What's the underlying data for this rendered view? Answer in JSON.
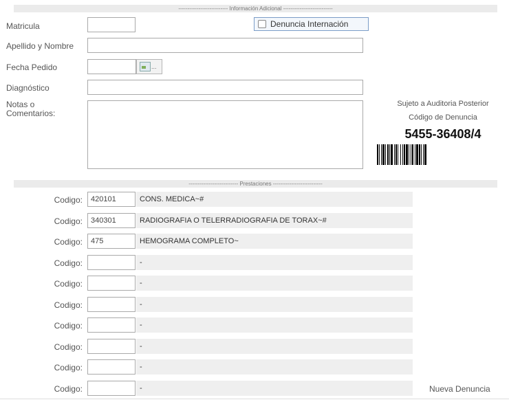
{
  "info_section_label": "--------------------------- Información Adicional ---------------------------",
  "fields": {
    "matricula_label": "Matricula",
    "denuncia_internacion_label": "Denuncia Internación",
    "apellido_label": "Apellido y Nombre",
    "fecha_label": "Fecha Pedido",
    "fecha_btn_text": "...",
    "diagnostico_label": "Diagnóstico",
    "notas_label_1": "Notas o",
    "notas_label_2": "Comentarios:"
  },
  "audit": {
    "sujeto": "Sujeto a Auditoria Posterior",
    "codigo_label": "Código de Denuncia",
    "codigo": "5455-36408/4"
  },
  "prestaciones_section_label": "--------------------------- Prestaciones ---------------------------",
  "codigo_label": "Codigo:",
  "prestaciones": [
    {
      "codigo": "420101",
      "descripcion": "CONS. MEDICA~#"
    },
    {
      "codigo": "340301",
      "descripcion": "RADIOGRAFIA O TELERRADIOGRAFIA DE TORAX~#"
    },
    {
      "codigo": "475",
      "descripcion": "HEMOGRAMA COMPLETO~"
    },
    {
      "codigo": "",
      "descripcion": "-"
    },
    {
      "codigo": "",
      "descripcion": "-"
    },
    {
      "codigo": "",
      "descripcion": "-"
    },
    {
      "codigo": "",
      "descripcion": "-"
    },
    {
      "codigo": "",
      "descripcion": "-"
    },
    {
      "codigo": "",
      "descripcion": "-"
    },
    {
      "codigo": "",
      "descripcion": "-"
    }
  ],
  "nueva_denuncia": "Nueva Denuncia"
}
